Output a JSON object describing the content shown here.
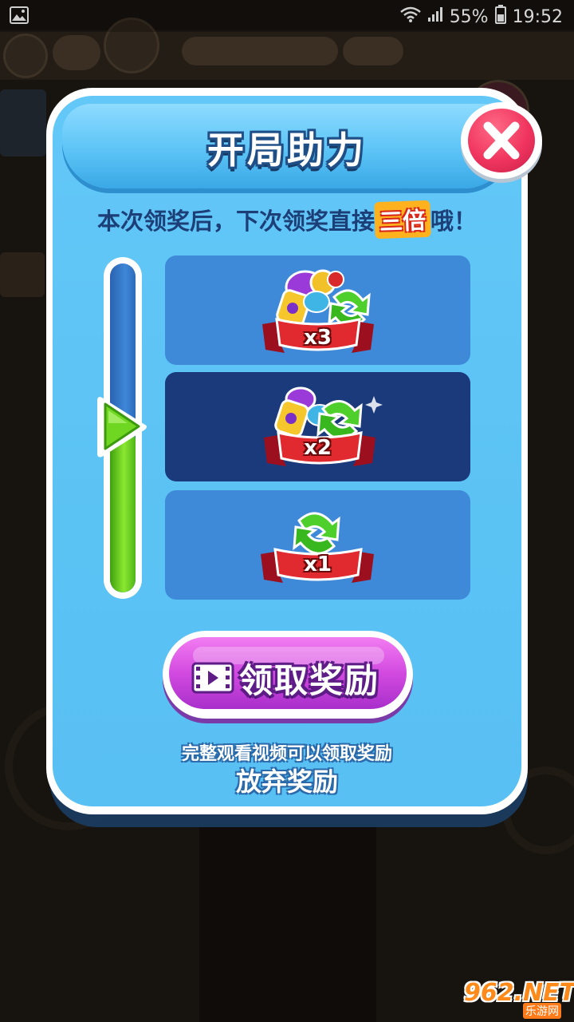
{
  "status_bar": {
    "signal": "55%",
    "time": "19:52"
  },
  "dialog": {
    "title": "开局助力",
    "subtitle_before": "本次领奖后，下次领奖直接",
    "subtitle_highlight": "三倍",
    "subtitle_after": "哦！",
    "progress_level": 0.5,
    "rewards": [
      {
        "label": "x3",
        "items": [
          "candy-icon",
          "swap-icon"
        ],
        "active": false
      },
      {
        "label": "x2",
        "items": [
          "candy-icon",
          "swap-icon"
        ],
        "active": true
      },
      {
        "label": "x1",
        "items": [
          "swap-icon"
        ],
        "active": false
      }
    ],
    "claim_button_label": "领取奖励",
    "hint_text": "完整观看视频可以领取奖励",
    "give_up_label": "放弃奖励"
  },
  "watermark": {
    "main": "962.NET",
    "sub": "乐游网"
  },
  "colors": {
    "panel": "#5bc2f4",
    "active_row": "#1b3a7c",
    "inactive_row": "#3f8ad8",
    "close": "#f0355f",
    "claim": "#d24ae0",
    "progress": "#8be831"
  }
}
